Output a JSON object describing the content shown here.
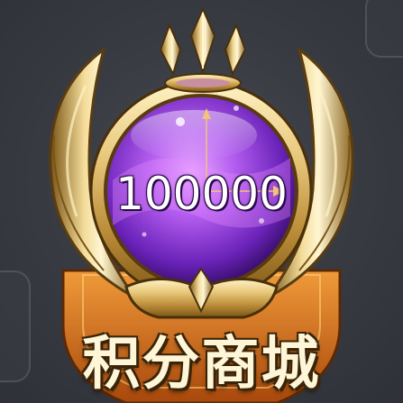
{
  "badge": {
    "points_value": "100000",
    "title": "积分商城"
  },
  "icons": {
    "crown": "crown-icon",
    "orb": "purple-orb",
    "wings": "golden-wings"
  },
  "colors": {
    "gold": "#e8c77a",
    "gold_dark": "#8a6420",
    "orb_purple": "#8e3fd6",
    "orb_light": "#d98cff",
    "shield_orange": "#d9741c",
    "background": "#3a3c43"
  }
}
